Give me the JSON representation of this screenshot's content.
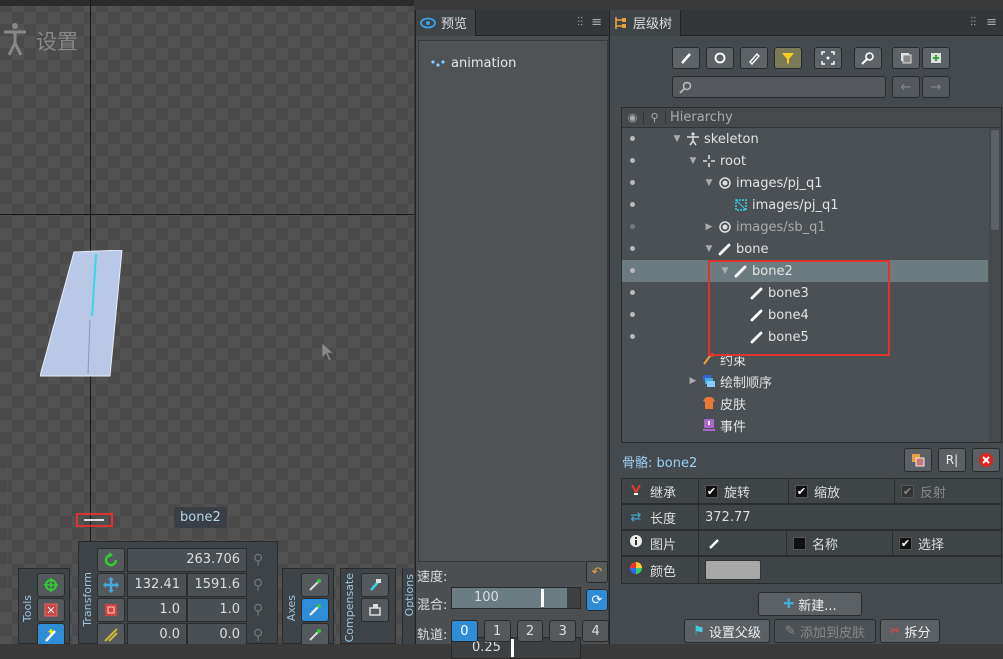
{
  "viewport": {
    "settings_label": "设置",
    "selected_bone_label": "bone2",
    "tools_tab": "Tools",
    "transform_tab": "Transform",
    "axes_tab": "Axes",
    "compensate_tab": "Compensate",
    "options_tab": "Options",
    "transform": {
      "rotation": "263.706",
      "translate_x": "132.41",
      "translate_y": "1591.6",
      "scale_x": "1.0",
      "scale_y": "1.0",
      "shear_x": "0.0",
      "shear_y": "0.0"
    }
  },
  "preview": {
    "tab_label": "预览",
    "animation_item": "animation",
    "speed_label": "速度:",
    "speed_value": "100",
    "speed_fraction": 0.9,
    "mix_label": "混合:",
    "mix_value": "0.25",
    "mix_fraction": 0.1,
    "tracks_label": "轨道:",
    "tracks": [
      "0",
      "1",
      "2",
      "3",
      "4"
    ],
    "active_track": "0"
  },
  "hierarchy": {
    "tab_label": "层级树",
    "search_placeholder": "",
    "header_label": "Hierarchy",
    "tree": [
      {
        "label": "skeleton",
        "icon": "skeleton-icon",
        "depth": 0,
        "expanded": true
      },
      {
        "label": "root",
        "icon": "bone-cross-icon",
        "depth": 1,
        "expanded": true
      },
      {
        "label": "images/pj_q1",
        "icon": "slot-icon",
        "depth": 2,
        "expanded": true
      },
      {
        "label": "images/pj_q1",
        "icon": "mesh-icon",
        "depth": 3
      },
      {
        "label": "images/sb_q1",
        "icon": "slot-icon",
        "depth": 2,
        "expanded": false,
        "dim": true
      },
      {
        "label": "bone",
        "icon": "bone-icon",
        "depth": 2,
        "expanded": true
      },
      {
        "label": "bone2",
        "icon": "bone-icon",
        "depth": 3,
        "expanded": true,
        "selected": true
      },
      {
        "label": "bone3",
        "icon": "bone-icon",
        "depth": 4
      },
      {
        "label": "bone4",
        "icon": "bone-icon",
        "depth": 4
      },
      {
        "label": "bone5",
        "icon": "bone-icon",
        "depth": 4
      },
      {
        "label": "约束",
        "icon": "constraint-icon",
        "depth": 1
      },
      {
        "label": "绘制顺序",
        "icon": "draw-order-icon",
        "depth": 1,
        "expanded": false
      },
      {
        "label": "皮肤",
        "icon": "skin-icon",
        "depth": 1
      },
      {
        "label": "事件",
        "icon": "event-icon",
        "depth": 1
      }
    ],
    "properties": {
      "title": "骨骼: bone2",
      "inherit_label": "继承",
      "rotate_label": "旋转",
      "rotate_checked": true,
      "scale_label": "缩放",
      "scale_checked": true,
      "reflect_label": "反射",
      "reflect_checked": true,
      "length_label": "长度",
      "length_value": "372.77",
      "image_label": "图片",
      "name_label": "名称",
      "name_checked": false,
      "select_label": "选择",
      "select_checked": true,
      "color_label": "颜色",
      "color_value": "#a8a8a8"
    },
    "buttons": {
      "new": "新建...",
      "set_parent": "设置父级",
      "add_to_skin": "添加到皮肤",
      "split": "拆分"
    }
  },
  "colors": {
    "accent": "#2f8cd6",
    "highlight_red": "#d33333",
    "selected_row": "#6c7b7f"
  }
}
